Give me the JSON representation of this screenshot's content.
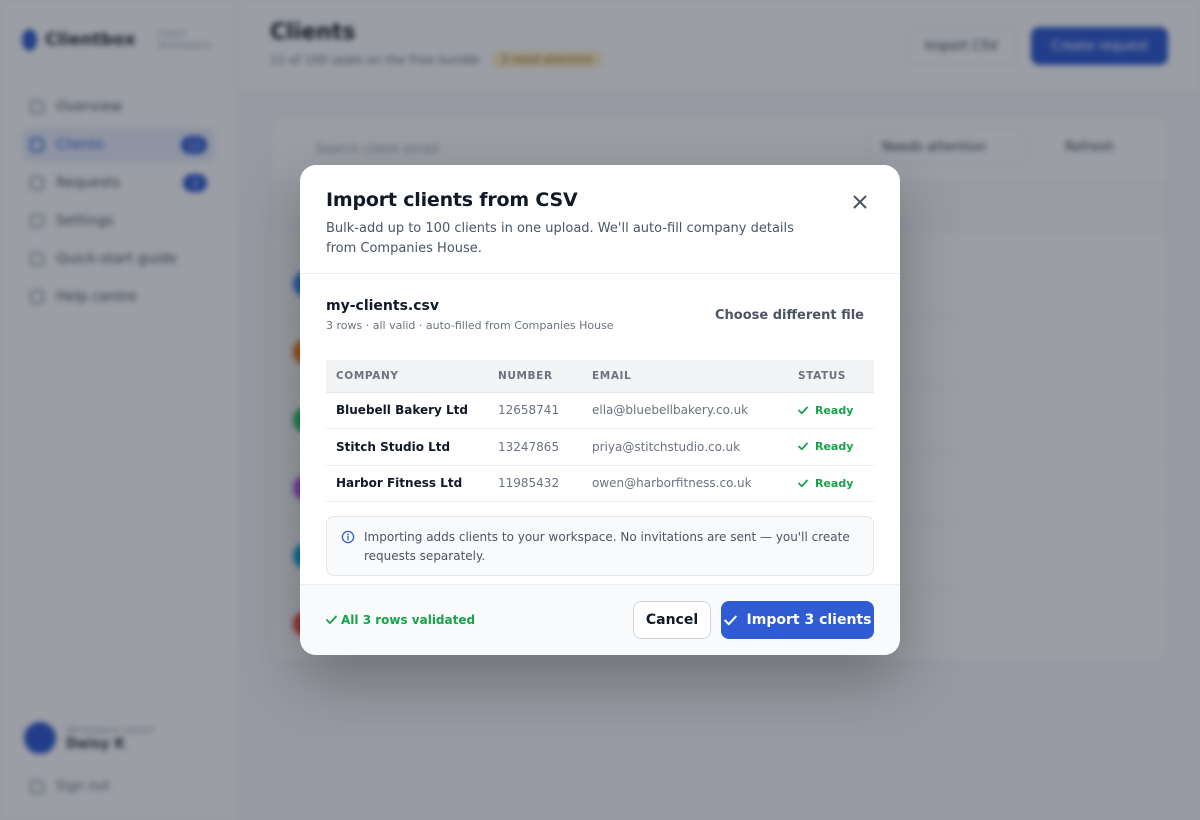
{
  "background": {
    "brand": {
      "name": "Clientbox",
      "tagline": "client workspace"
    },
    "nav": [
      {
        "label": "Overview",
        "badge": ""
      },
      {
        "label": "Clients",
        "badge": "12",
        "active": true
      },
      {
        "label": "Requests",
        "badge": "3"
      },
      {
        "label": "Settings",
        "badge": ""
      },
      {
        "label": "Quick-start guide",
        "badge": ""
      },
      {
        "label": "Help centre",
        "badge": ""
      }
    ],
    "user": {
      "name": "Daisy K",
      "role": "Workspace owner"
    },
    "sign_out": "Sign out",
    "page_title": "Clients",
    "page_subtitle": "12 of 100 seats on the Free bundle",
    "warning_pill": "2 need attention",
    "import_csv": "Import CSV",
    "create_request": "Create request",
    "search_placeholder": "Search client email",
    "filter": "Needs attention",
    "refresh": "Refresh"
  },
  "modal": {
    "title": "Import clients from CSV",
    "description": "Bulk-add up to 100 clients in one upload. We'll auto-fill company details from Companies House.",
    "file": {
      "name": "my-clients.csv",
      "meta": "3 rows · all valid · auto-filled from Companies House",
      "change_label": "Choose different file"
    },
    "table": {
      "headers": [
        "COMPANY",
        "NUMBER",
        "EMAIL",
        "STATUS"
      ],
      "rows": [
        {
          "company": "Bluebell Bakery Ltd",
          "number": "12658741",
          "email": "ella@bluebellbakery.co.uk",
          "status": "Ready"
        },
        {
          "company": "Stitch Studio Ltd",
          "number": "13247865",
          "email": "priya@stitchstudio.co.uk",
          "status": "Ready"
        },
        {
          "company": "Harbor Fitness Ltd",
          "number": "11985432",
          "email": "owen@harborfitness.co.uk",
          "status": "Ready"
        }
      ]
    },
    "info": "Importing adds clients to your workspace. No invitations are sent — you'll create requests separately.",
    "footer": {
      "validated": "All 3 rows validated",
      "cancel": "Cancel",
      "import": "Import 3 clients"
    },
    "colors": {
      "accent": "#2f5bd3",
      "success": "#16a34a"
    }
  }
}
